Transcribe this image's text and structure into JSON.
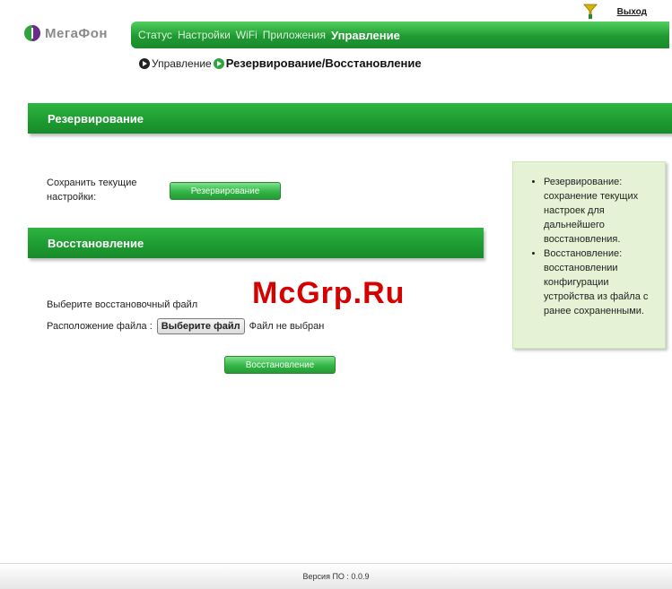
{
  "header": {
    "logout": "Выход",
    "brand": "МегаФон"
  },
  "nav": {
    "items": [
      "Статус",
      "Настройки",
      "WiFi",
      "Приложения",
      "Управление"
    ]
  },
  "breadcrumb": {
    "parent": "Управление",
    "current": "Резервирование/Восстановление"
  },
  "backup": {
    "title": "Резервирование",
    "label_line1": "Сохранить текущие",
    "label_line2": "настройки:",
    "button": "Резервирование"
  },
  "restore": {
    "title": "Восстановление",
    "select_label": "Выберите восстановочный файл",
    "location_label": "Расположение файла :",
    "file_button": "Выберите файл",
    "file_status": "Файл не выбран",
    "button": "Восстановление"
  },
  "help": {
    "items": [
      "Резервирование: сохранение текущих настроек для дальнейшего восстановления.",
      "Восстановление: восстановлении конфигурации устройства из файла с ранее сохраненными."
    ]
  },
  "watermark": "McGrp.Ru",
  "footer": {
    "version": "Версия ПО : 0.0.9"
  },
  "colors": {
    "brand_green": "#1f9a32",
    "help_bg": "#e5f2d6"
  }
}
